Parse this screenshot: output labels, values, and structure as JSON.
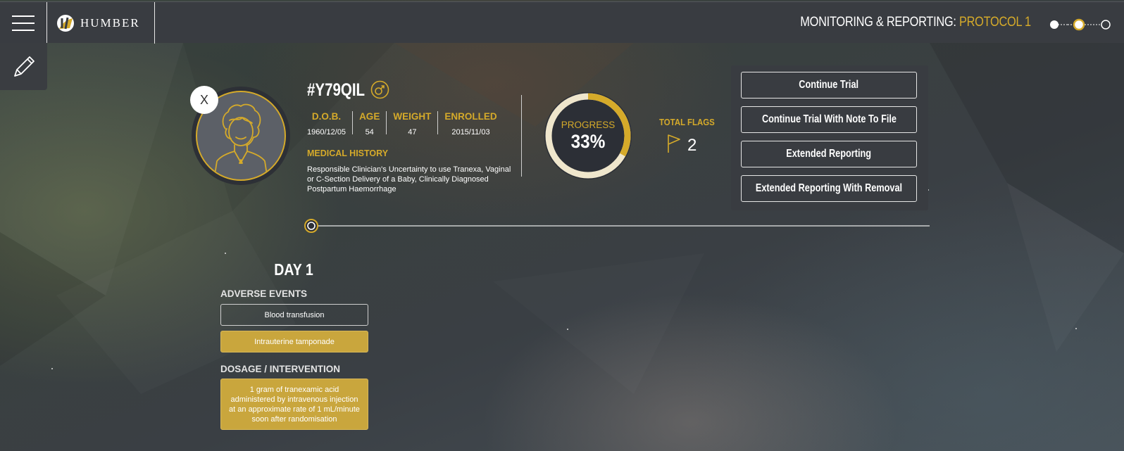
{
  "colors": {
    "accent": "#d5aa2a",
    "bar": "#393c41",
    "chip": "#c9a63d"
  },
  "header": {
    "logo_text": "HUMBER",
    "title_prefix": "MONITORING & REPORTING: ",
    "title_protocol": "PROTOCOL 1",
    "stepper": {
      "steps": 3,
      "current": 2
    }
  },
  "patient": {
    "id": "#Y79QIL",
    "gender_icon": "male-icon",
    "close_label": "X",
    "stats": [
      {
        "label": "D.O.B.",
        "value": "1960/12/05"
      },
      {
        "label": "AGE",
        "value": "54"
      },
      {
        "label": "WEIGHT",
        "value": "47"
      },
      {
        "label": "ENROLLED",
        "value": "2015/11/03"
      }
    ],
    "medical_history_label": "MEDICAL HISTORY",
    "medical_history": "Responsible Clinician's Uncertainty to use Tranexa, Vaginal or C-Section Delivery of a Baby, Clinically Diagnosed Postpartum Haemorrhage"
  },
  "progress": {
    "label": "PROGRESS",
    "value_text": "33%",
    "fraction": 0.33
  },
  "flags": {
    "label": "TOTAL FLAGS",
    "count": "2"
  },
  "actions": [
    "Continue Trial",
    "Continue Trial With Note To File",
    "Extended Reporting",
    "Extended Reporting With Removal"
  ],
  "day": {
    "title": "DAY 1",
    "adverse_label": "ADVERSE EVENTS",
    "adverse_events": [
      "Blood transfusion",
      "Intrauterine tamponade"
    ],
    "dosage_label": "DOSAGE / INTERVENTION",
    "dosage": "1 gram of tranexamic acid administered by intravenous injection at an approximate rate of 1 mL/minute soon after randomisation"
  }
}
